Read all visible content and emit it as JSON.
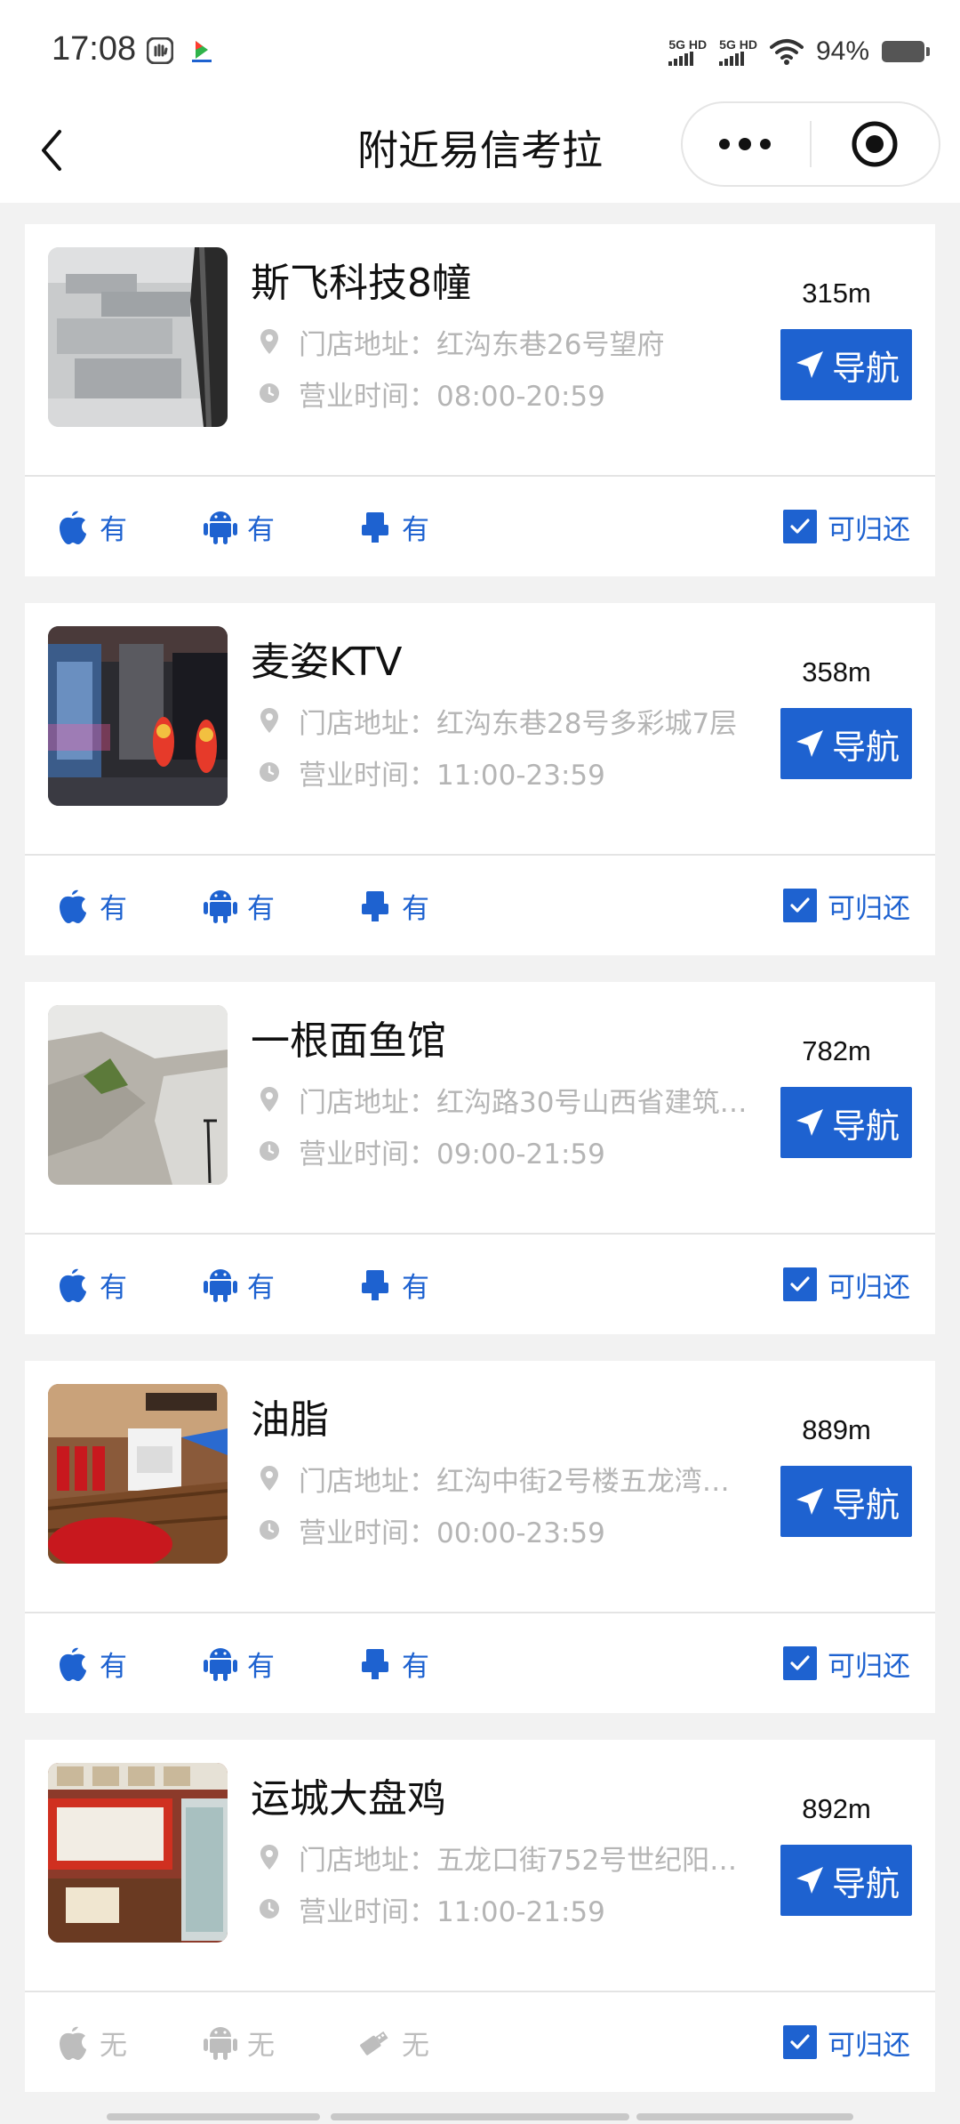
{
  "status_bar": {
    "time": "17:08",
    "signal1_label": "5G HD",
    "signal2_label": "5G HD",
    "battery": "94%"
  },
  "nav": {
    "title": "附近易信考拉",
    "back_icon": "chevron-left-icon",
    "more_icon": "more-dots-icon",
    "close_icon": "target-close-icon"
  },
  "colors": {
    "accent": "#1e62d0",
    "muted_text": "#b5b5b5",
    "disabled": "#bdbdbd"
  },
  "stores": [
    {
      "name": "斯飞科技8幢",
      "address": "门店地址：红沟东巷26号望府",
      "hours": "营业时间：08:00-20:59",
      "distance": "315m",
      "nav_label": "导航",
      "apple": "有",
      "android": "有",
      "usb": "有",
      "apple_on": true,
      "android_on": true,
      "usb_on": true,
      "returnable": "可归还",
      "thumb": "buildings"
    },
    {
      "name": "麦姿KTV",
      "address": "门店地址：红沟东巷28号多彩城7层",
      "hours": "营业时间：11:00-23:59",
      "distance": "358m",
      "nav_label": "导航",
      "apple": "有",
      "android": "有",
      "usb": "有",
      "apple_on": true,
      "android_on": true,
      "usb_on": true,
      "returnable": "可归还",
      "thumb": "ktv"
    },
    {
      "name": "一根面鱼馆",
      "address": "门店地址：红沟路30号山西省建筑…",
      "hours": "营业时间：09:00-21:59",
      "distance": "782m",
      "nav_label": "导航",
      "apple": "有",
      "android": "有",
      "usb": "有",
      "apple_on": true,
      "android_on": true,
      "usb_on": true,
      "returnable": "可归还",
      "thumb": "ground"
    },
    {
      "name": "油脂",
      "address": "门店地址：红沟中街2号楼五龙湾…",
      "hours": "营业时间：00:00-23:59",
      "distance": "889m",
      "nav_label": "导航",
      "apple": "有",
      "android": "有",
      "usb": "有",
      "apple_on": true,
      "android_on": true,
      "usb_on": true,
      "returnable": "可归还",
      "thumb": "room"
    },
    {
      "name": "运城大盘鸡",
      "address": "门店地址：五龙口街752号世纪阳…",
      "hours": "营业时间：11:00-21:59",
      "distance": "892m",
      "nav_label": "导航",
      "apple": "无",
      "android": "无",
      "usb": "无",
      "apple_on": false,
      "android_on": false,
      "usb_on": false,
      "returnable": "可归还",
      "thumb": "restaurant"
    }
  ]
}
